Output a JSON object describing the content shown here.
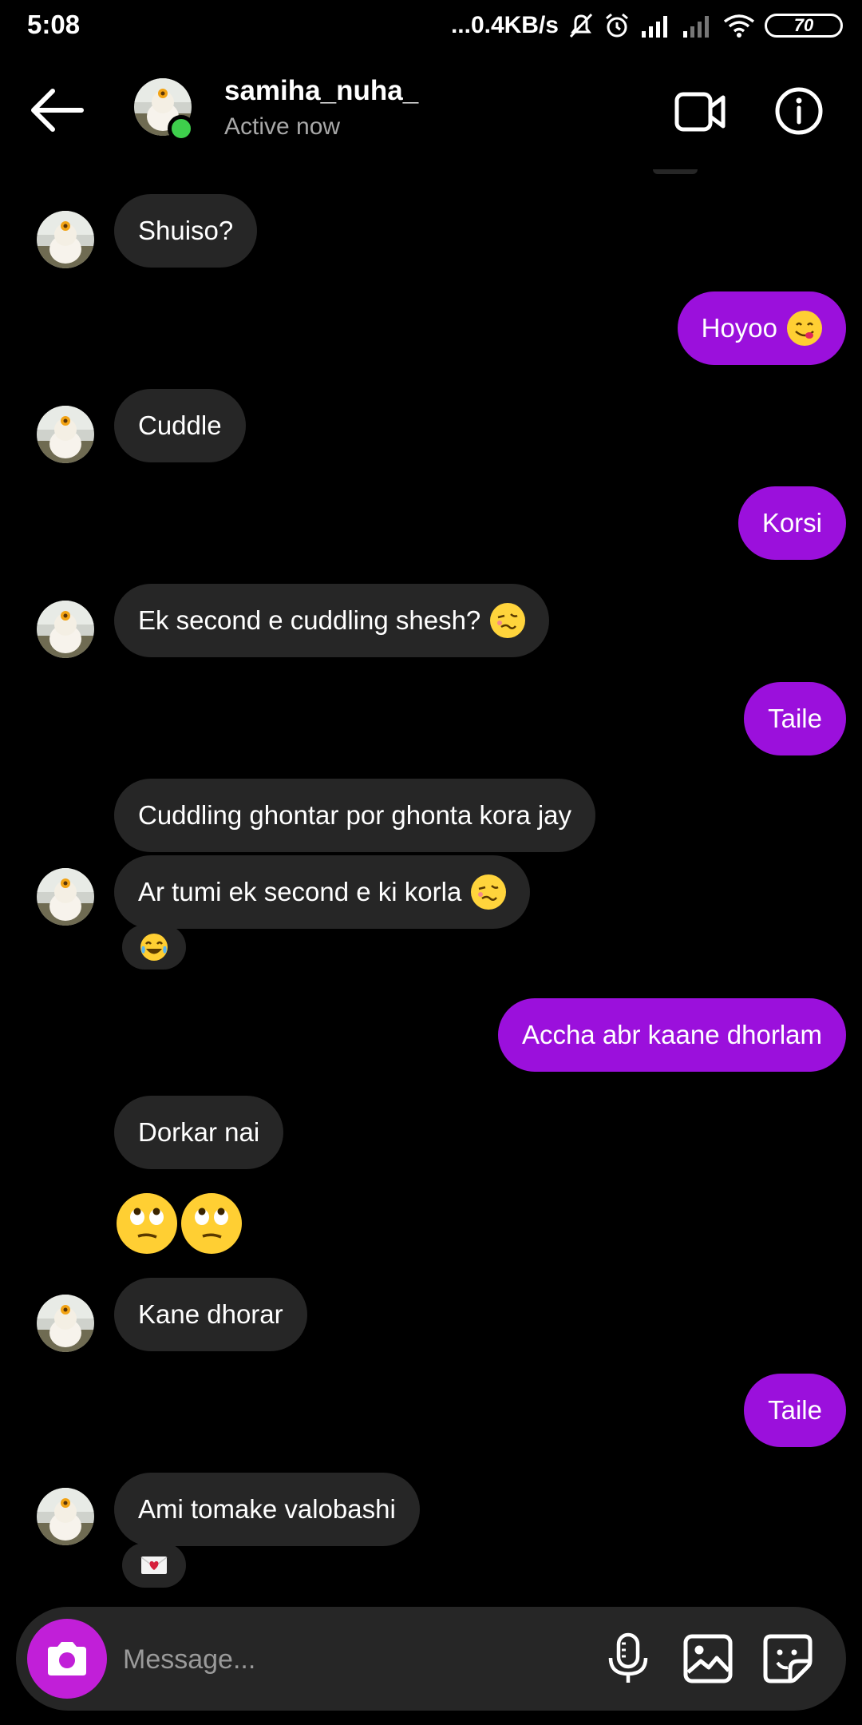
{
  "status_bar": {
    "time": "5:08",
    "network_speed": "...0.4KB/s",
    "battery": "70"
  },
  "header": {
    "username": "samiha_nuha_",
    "status": "Active now",
    "icons": {
      "back": "arrow-left-icon",
      "video": "video-camera-icon",
      "info": "info-icon"
    }
  },
  "messages": [
    {
      "direction": "in",
      "text": "Shuiso?"
    },
    {
      "direction": "out",
      "text": "Hoyoo",
      "emoji": "face-savoring-food"
    },
    {
      "direction": "in",
      "text": "Cuddle"
    },
    {
      "direction": "out",
      "text": "Korsi"
    },
    {
      "direction": "in",
      "text": "Ek second e cuddling shesh?",
      "emoji": "woozy-face"
    },
    {
      "direction": "out",
      "text": "Taile"
    },
    {
      "direction": "in",
      "text": "Cuddling ghontar por ghonta kora jay"
    },
    {
      "direction": "in",
      "text": "Ar tumi ek second e ki korla",
      "emoji": "woozy-face",
      "reaction": "tears-of-joy"
    },
    {
      "direction": "out",
      "text": "Accha abr kaane dhorlam"
    },
    {
      "direction": "in",
      "text": "Dorkar nai"
    },
    {
      "direction": "in",
      "emoji_only": [
        "face-with-rolling-eyes",
        "face-with-rolling-eyes"
      ]
    },
    {
      "direction": "in",
      "text": "Kane dhorar"
    },
    {
      "direction": "out",
      "text": "Taile"
    },
    {
      "direction": "in",
      "text": "Ami tomake valobashi",
      "reaction": "love-letter"
    }
  ],
  "composer": {
    "placeholder": "Message...",
    "icons": [
      "camera-icon",
      "microphone-icon",
      "gallery-icon",
      "sticker-icon"
    ]
  },
  "colors": {
    "background": "#000000",
    "incoming_bubble": "#262626",
    "outgoing_bubble": "#9b10dc",
    "camera_button": "#c11fd8",
    "online_dot": "#3ecf4c",
    "secondary_text": "#a8a8a8"
  }
}
